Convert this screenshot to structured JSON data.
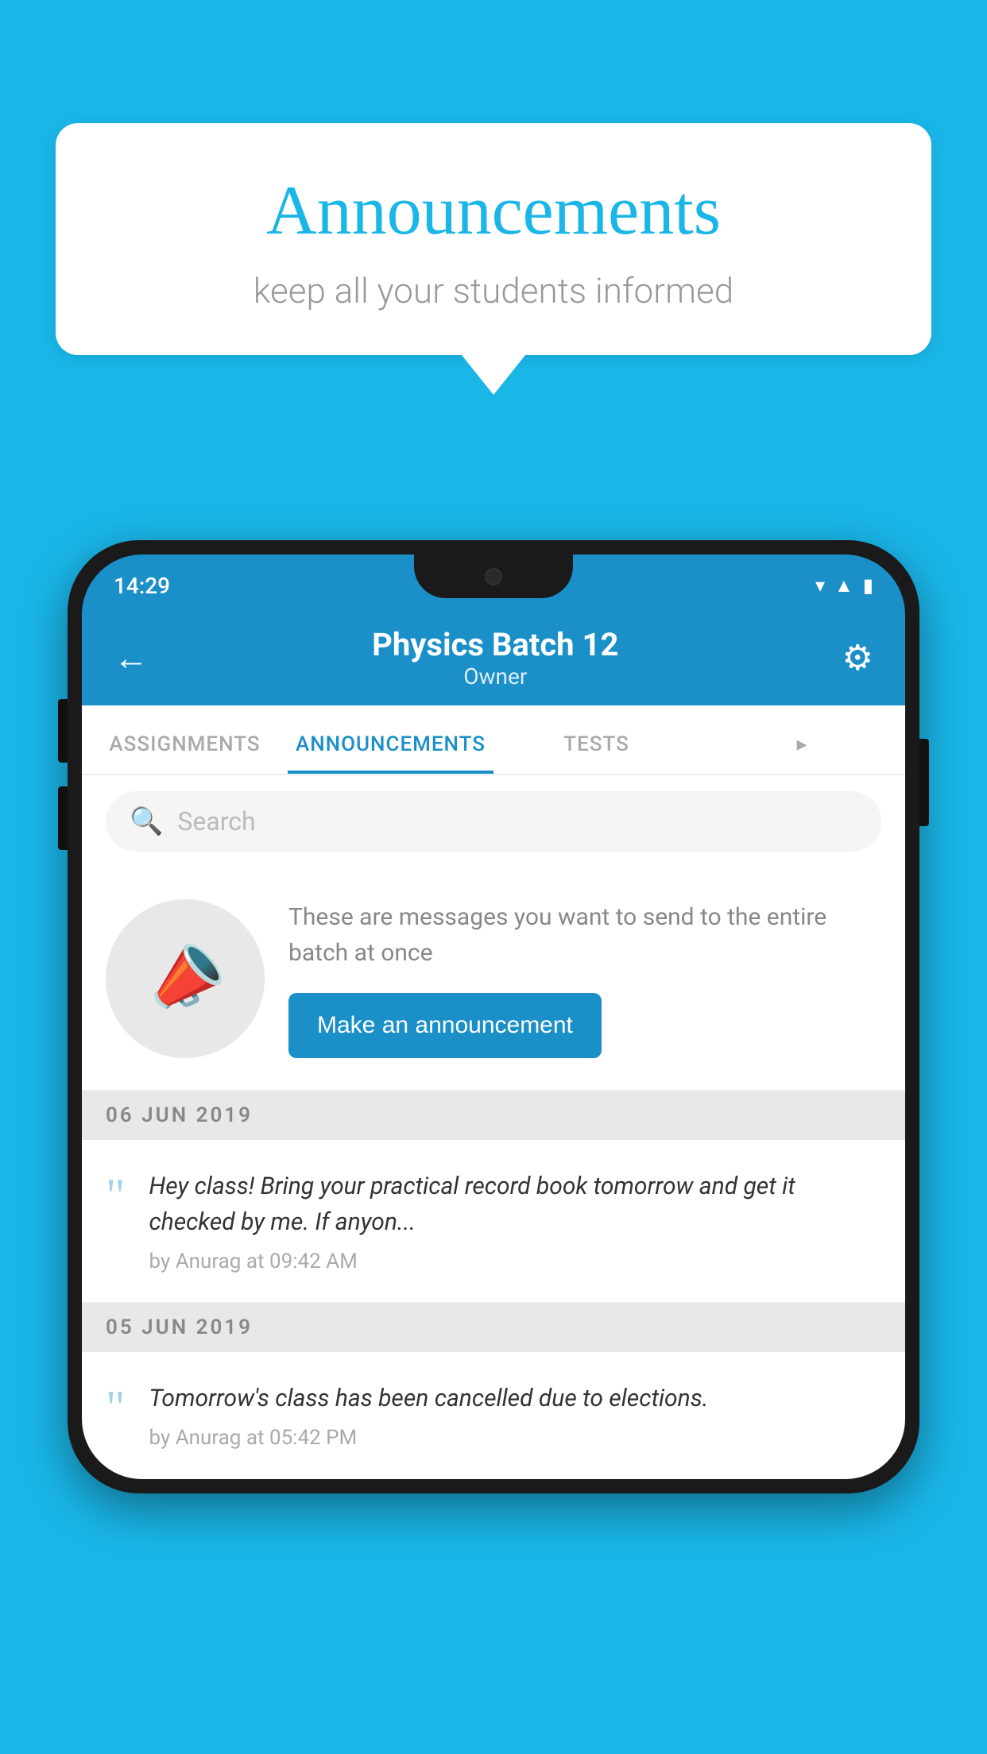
{
  "background_color": "#1ab6e8",
  "bubble": {
    "title": "Announcements",
    "subtitle": "keep all your students informed"
  },
  "phone": {
    "status_bar": {
      "time": "14:29",
      "icons": [
        "wifi",
        "signal",
        "battery"
      ]
    },
    "header": {
      "title": "Physics Batch 12",
      "subtitle": "Owner",
      "back_label": "←",
      "gear_label": "⚙"
    },
    "tabs": [
      {
        "label": "ASSIGNMENTS",
        "active": false
      },
      {
        "label": "ANNOUNCEMENTS",
        "active": true
      },
      {
        "label": "TESTS",
        "active": false
      },
      {
        "label": "...",
        "active": false
      }
    ],
    "search": {
      "placeholder": "Search"
    },
    "promo": {
      "text": "These are messages you want to send to the entire batch at once",
      "button_label": "Make an announcement"
    },
    "date_sections": [
      {
        "date": "06  JUN  2019",
        "announcements": [
          {
            "text": "Hey class! Bring your practical record book tomorrow and get it checked by me. If anyon...",
            "meta": "by Anurag at 09:42 AM"
          }
        ]
      },
      {
        "date": "05  JUN  2019",
        "announcements": [
          {
            "text": "Tomorrow's class has been cancelled due to elections.",
            "meta": "by Anurag at 05:42 PM"
          }
        ]
      }
    ]
  }
}
